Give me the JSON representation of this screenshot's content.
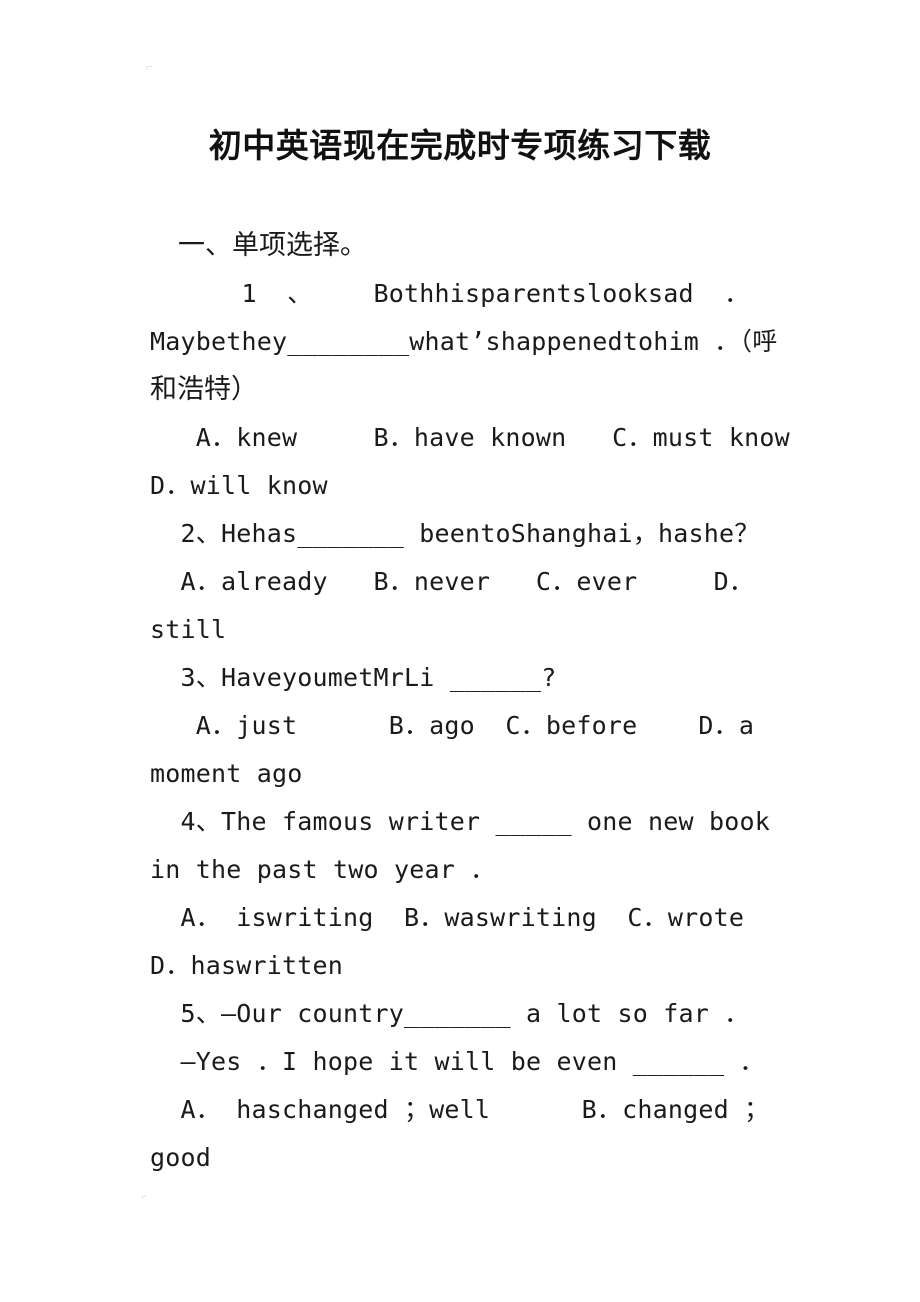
{
  "document": {
    "title": "初中英语现在完成时专项练习下载",
    "section_heading": "一、单项选择。"
  },
  "artifacts": {
    "top_mark": "⌐",
    "bottom_mark": "⌐"
  },
  "lines": [
    {
      "id": "q1-l1",
      "text": "      1  、    Bothhisparentslooksad  ．"
    },
    {
      "id": "q1-l2",
      "text": "Maybethey________what’shappenedtohim ．（呼"
    },
    {
      "id": "q1-l3",
      "text": "和浩特）"
    },
    {
      "id": "q1-opts-l1",
      "text": "   A．knew     B．have known   C．must know"
    },
    {
      "id": "q1-opts-l2",
      "text": "D．will know"
    },
    {
      "id": "q2-l1",
      "text": "  2、Hehas_______ beentoShanghai，hashe？"
    },
    {
      "id": "q2-opts-l1",
      "text": "  A．already   B．never   C．ever     D．"
    },
    {
      "id": "q2-opts-l2",
      "text": "still"
    },
    {
      "id": "q3-l1",
      "text": "  3、HaveyoumetMrLi ______?"
    },
    {
      "id": "q3-opts-l1",
      "text": "   A．just      B．ago  C．before    D．a"
    },
    {
      "id": "q3-opts-l2",
      "text": "moment ago"
    },
    {
      "id": "q4-l1",
      "text": "  4、The famous writer _____ one new book"
    },
    {
      "id": "q4-l2",
      "text": "in the past two year ．"
    },
    {
      "id": "q4-opts-l1",
      "text": "  A． iswriting  B．waswriting  C．wrote"
    },
    {
      "id": "q4-opts-l2",
      "text": "D．haswritten"
    },
    {
      "id": "q5-l1",
      "text": "  5、—Our country_______ a lot so far ．"
    },
    {
      "id": "q5-l2",
      "text": "  —Yes ．I hope it will be even ______ ．"
    },
    {
      "id": "q5-opts-l1",
      "text": "  A． haschanged ；well      B．changed ；"
    },
    {
      "id": "q5-opts-l2",
      "text": "good"
    }
  ]
}
